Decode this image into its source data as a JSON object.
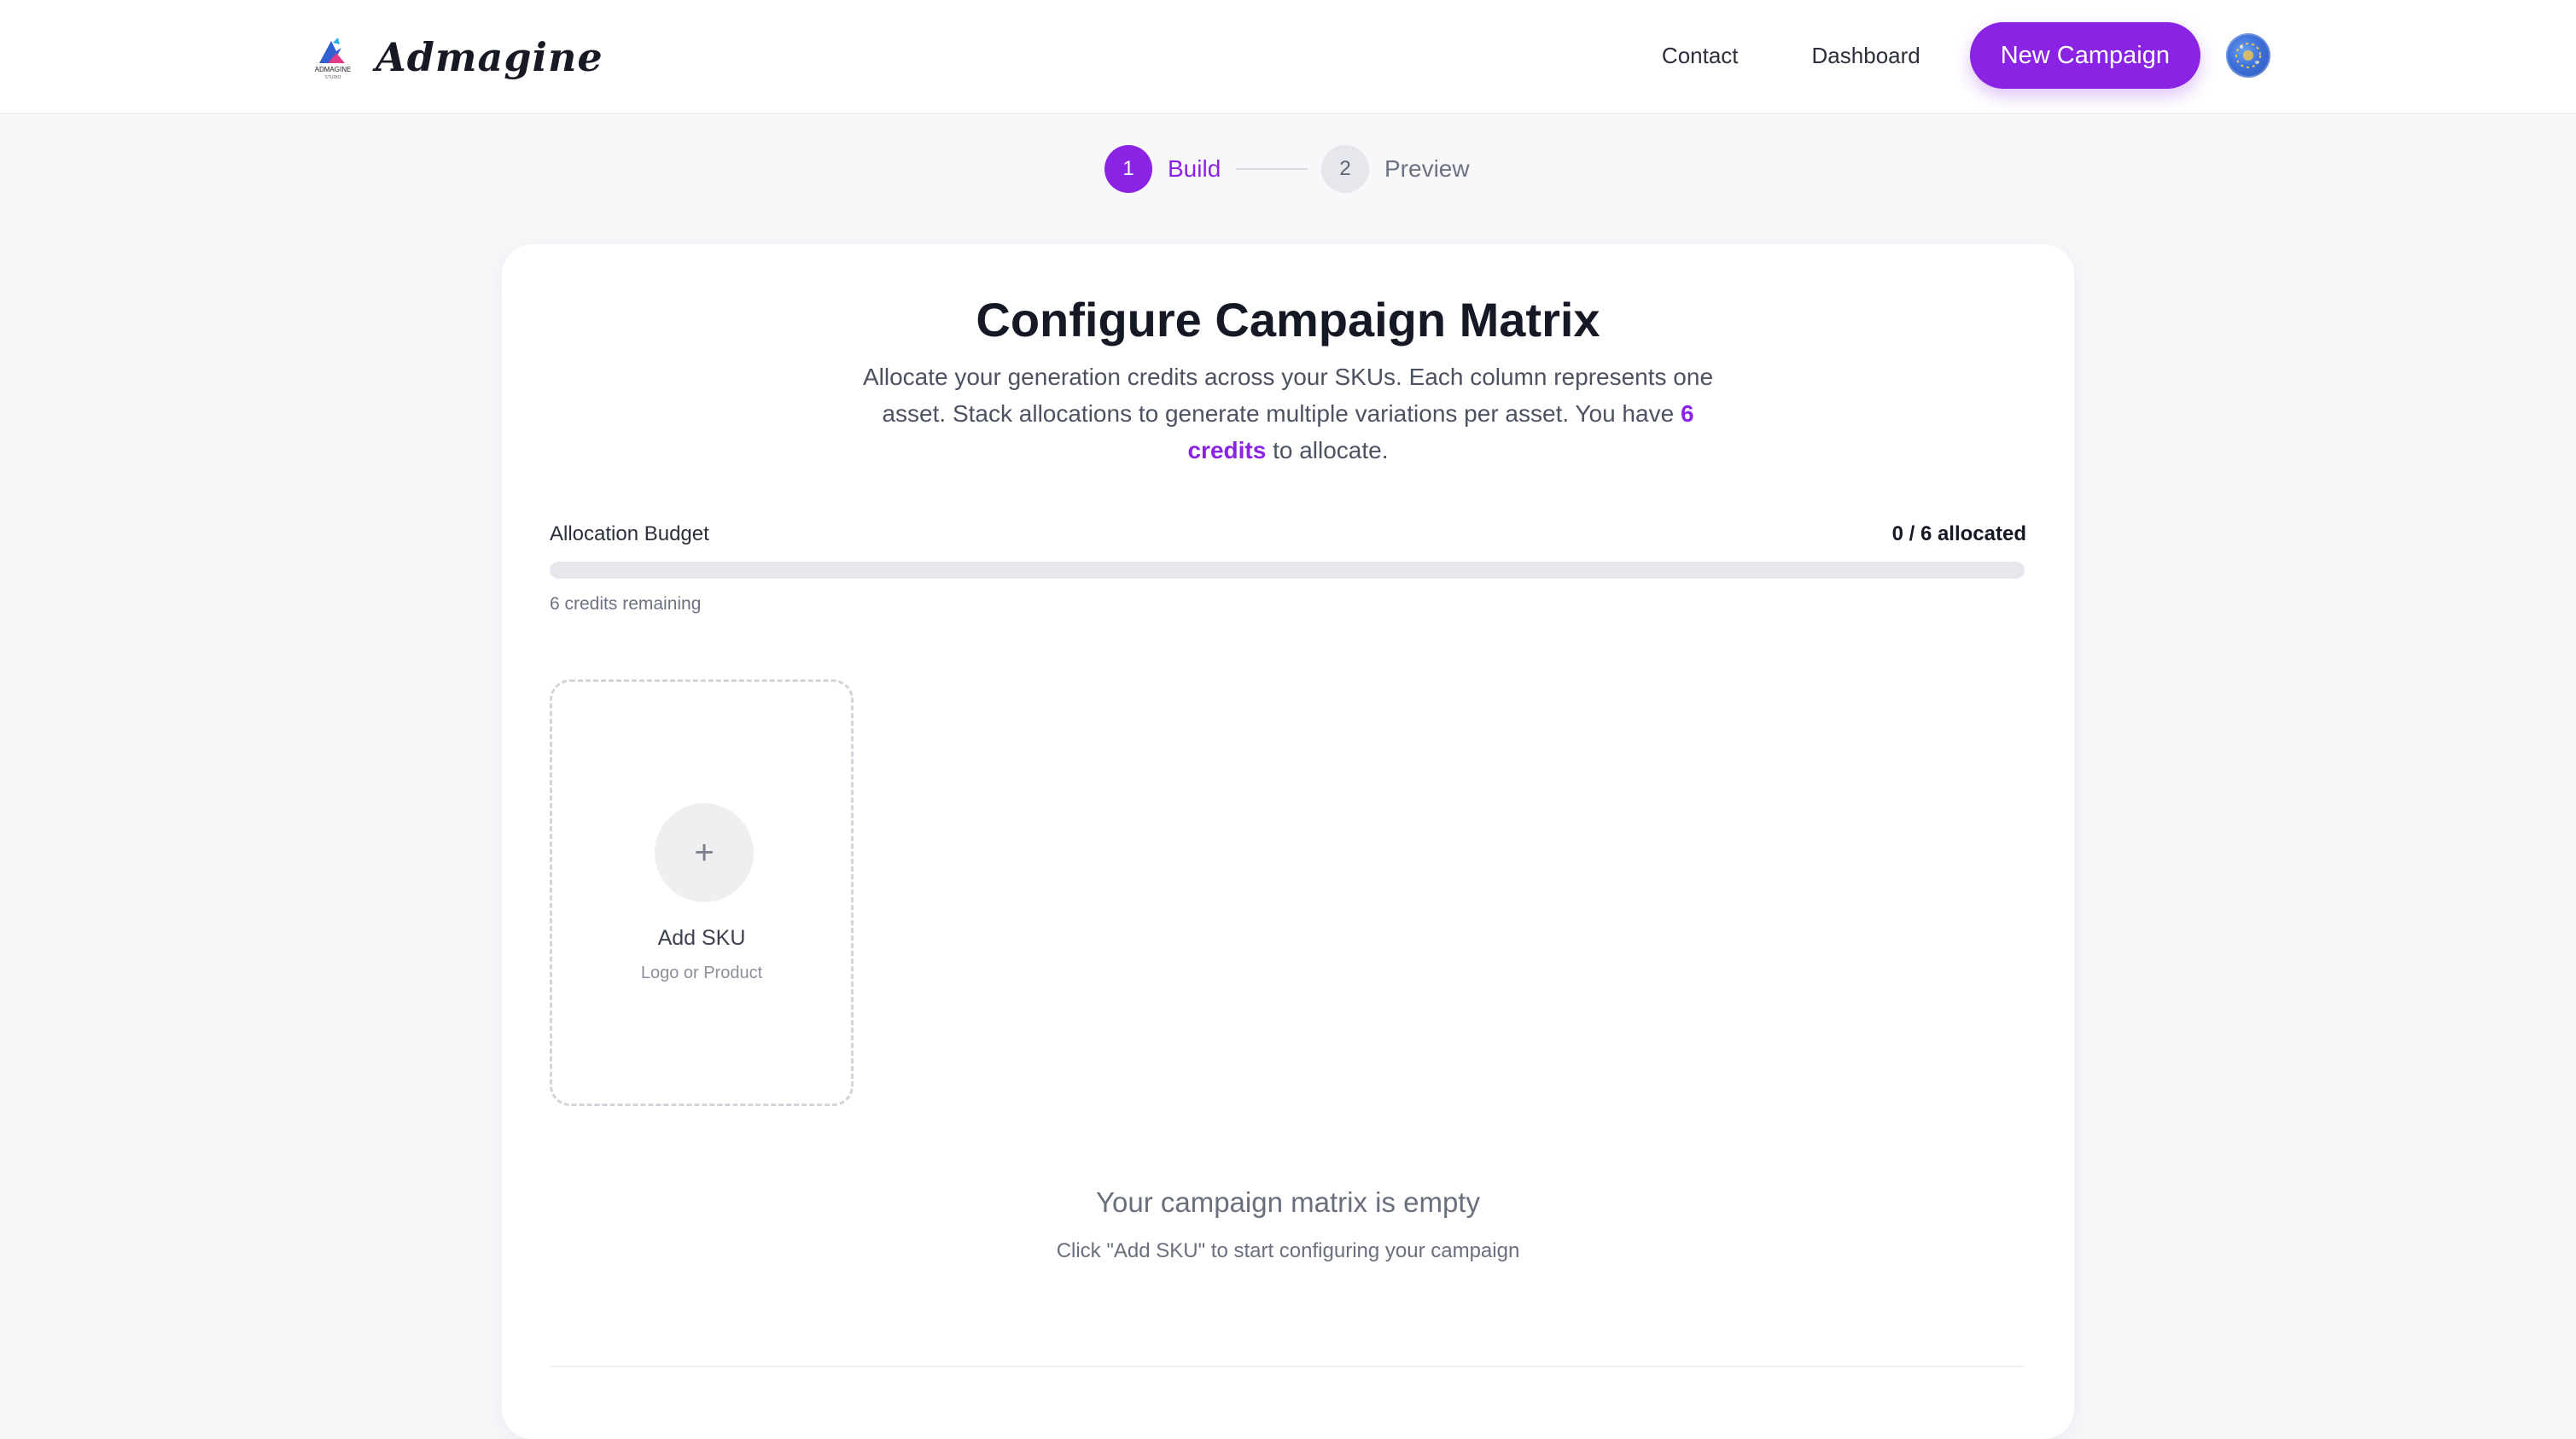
{
  "header": {
    "brand_name": "Admagine",
    "logo_caption": "ADMAGINE",
    "logo_subcaption": "STUDIO",
    "nav": {
      "contact": "Contact",
      "dashboard": "Dashboard"
    },
    "cta_label": "New Campaign"
  },
  "stepper": {
    "steps": [
      {
        "number": "1",
        "label": "Build",
        "state": "active"
      },
      {
        "number": "2",
        "label": "Preview",
        "state": "inactive"
      }
    ]
  },
  "card": {
    "title": "Configure Campaign Matrix",
    "description_before": "Allocate your generation credits across your SKUs. Each column represents one asset. Stack allocations to generate multiple variations per asset. You have ",
    "credits_highlight": "6 credits",
    "description_after": " to allocate.",
    "budget": {
      "label": "Allocation Budget",
      "count": "0 / 6 allocated",
      "allocated": 0,
      "total": 6,
      "remaining_text": "6 credits remaining"
    },
    "add_sku": {
      "icon": "+",
      "title": "Add SKU",
      "subtitle": "Logo or Product"
    },
    "empty_state": {
      "title": "Your campaign matrix is empty",
      "subtitle": "Click \"Add SKU\" to start configuring your campaign"
    }
  },
  "colors": {
    "accent": "#8a23e3",
    "background": "#f8f8fb",
    "card": "#ffffff",
    "track": "#e6e7ec"
  }
}
